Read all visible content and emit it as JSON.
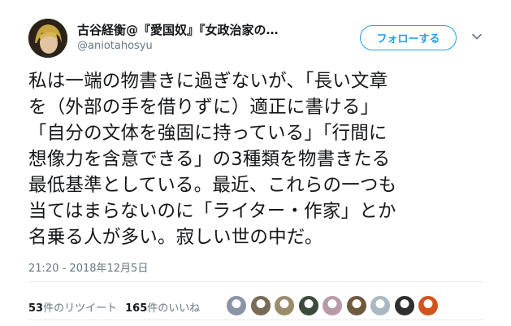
{
  "tweet": {
    "display_name": "古谷経衡@『愛国奴』『女政治家の…",
    "handle": "@aniotahosyu",
    "follow_label": "フォローする",
    "text": "私は一端の物書きに過ぎないが、「長い文章\nを（外部の手を借りずに）適正に書ける」\n「自分の文体を強固に持っている」「行間に\n想像力を含意できる」の3種類を物書きたる\n最低基準としている。最近、これらの一つも\n当てはまらないのに「ライター・作家」とか\n名乗る人が多い。寂しい世の中だ。",
    "timestamp": "21:20 - 2018年12月5日",
    "retweet_count": "53",
    "retweet_label": "件のリツイート",
    "like_count": "165",
    "like_label": "件のいいね"
  },
  "likers": [
    {
      "icon": "liker-avatar-icon",
      "color": "#8a94a6"
    },
    {
      "icon": "liker-avatar-icon",
      "color": "#7a6a58"
    },
    {
      "icon": "liker-avatar-icon",
      "color": "#9b8d6c"
    },
    {
      "icon": "liker-avatar-icon",
      "color": "#3c4a3a"
    },
    {
      "icon": "liker-avatar-icon",
      "color": "#b89aa8"
    },
    {
      "icon": "liker-avatar-icon",
      "color": "#6e5a3c"
    },
    {
      "icon": "liker-avatar-icon",
      "color": "#aab8c2"
    },
    {
      "icon": "liker-avatar-icon",
      "color": "#2f2f2f"
    },
    {
      "icon": "liker-avatar-icon",
      "color": "#d2541c"
    }
  ],
  "colors": {
    "accent": "#1da1f2",
    "text": "#14171a",
    "secondary": "#657786",
    "divider": "#e6ecf0"
  }
}
